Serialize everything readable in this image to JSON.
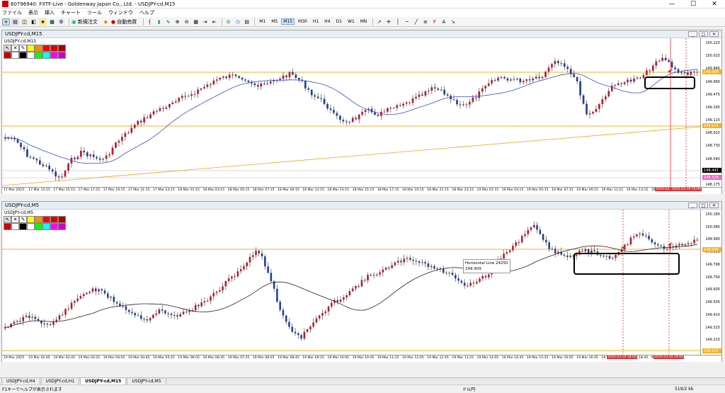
{
  "window": {
    "title": "60796940: FXTF-Live - Goldenway Japan Co., Ltd. - USDJPY-cd,M15",
    "minimize": "—",
    "maximize": "☐",
    "close": "✕"
  },
  "menu": [
    "ファイル",
    "表示",
    "挿入",
    "チャート",
    "ツール",
    "ウィンドウ",
    "ヘルプ"
  ],
  "toolbar": {
    "new_order": "新規注文",
    "auto_trade": "自動売買",
    "timeframes": [
      "M1",
      "M5",
      "M15",
      "M30",
      "H1",
      "H4",
      "D1",
      "W1",
      "MN"
    ],
    "selected_timeframe": "M15"
  },
  "chart_top": {
    "window_title": "USDJPY-cd,M15",
    "symbol_label": "USDJPY-cd,M15",
    "price_ticks": [
      "150.220",
      "150.015",
      "149.845",
      "149.660",
      "149.475",
      "149.295",
      "149.115",
      "148.915",
      "148.730",
      "148.540",
      "148.360",
      "148.175"
    ],
    "price_boxes": [
      {
        "label": "149.909",
        "color": "#f5b324"
      },
      {
        "label": "149.114",
        "color": "#f5b324"
      },
      {
        "label": "148.443",
        "color": "#000000"
      },
      {
        "label": "148.328",
        "color": "#e86ac8"
      }
    ],
    "time_labels": [
      "17 Mar 2025",
      "17 Mar 13:15",
      "17 Mar 15:15",
      "17 Mar 17:15",
      "17 Mar 19:15",
      "17 Mar 21:15",
      "17 Mar 23:15",
      "18 Mar 01:15",
      "18 Mar 03:15",
      "18 Mar 05:15",
      "18 Mar 07:15",
      "18 Mar 09:15",
      "18 Mar 11:15",
      "18 Mar 13:15",
      "18 Mar 15:15",
      "18 Mar 17:15",
      "18 Mar 19:15",
      "18 Mar 21:15",
      "18 Mar 23:15",
      "19 Mar 01:15",
      "19 Mar 03:15",
      "19 Mar 05:15",
      "19 Mar 07:15",
      "19 Mar 09:15",
      "19 Mar 11:15",
      "19 Mar 13:15",
      "19 Mar 15:15"
    ],
    "time_markers": [
      "2025.03..",
      "2025.03.19 15:00"
    ]
  },
  "chart_bottom": {
    "window_title": "USDJPY-cd,M5",
    "symbol_label": "USDJPY-cd,M5",
    "price_ticks": [
      "150.180",
      "150.085",
      "149.990",
      "149.895",
      "149.796",
      "149.700",
      "149.605",
      "149.505",
      "149.410",
      "149.315",
      "149.215",
      "149.120"
    ],
    "price_boxes": [
      {
        "label": "149.909",
        "color": "#f5b324"
      },
      {
        "label": "149.114",
        "color": "#f5b324"
      }
    ],
    "time_labels": [
      "19 Mar 2025",
      "19 Mar 02:05",
      "19 Mar 02:45",
      "19 Mar 03:25",
      "19 Mar 04:05",
      "19 Mar 04:45",
      "19 Mar 05:25",
      "19 Mar 06:05",
      "19 Mar 06:45",
      "19 Mar 07:25",
      "19 Mar 08:05",
      "19 Mar 08:45",
      "19 Mar 09:25",
      "19 Mar 10:05",
      "19 Mar 10:45",
      "19 Mar 11:25",
      "19 Mar 12:05",
      "19 Mar 12:45",
      "19 Mar 13:25",
      "19 Mar 14:05",
      "19 Mar 14:45",
      "19 Mar 15:25",
      "19 Mar 16:05",
      "19 Mar 16:45",
      "19 Mar 17:25",
      "19 Mar 18:45",
      "Mar 20:05"
    ],
    "time_markers": [
      "2025.03.19 18:00",
      "2025.03.19 19:00"
    ],
    "tooltip_line1": "Horizontal Line 24250",
    "tooltip_line2": "149.909"
  },
  "tabs": [
    "USDJPY-cd,H4",
    "USDJPY-cd,H1",
    "USDJPY-cd,M15",
    "USDJPY-cd,M5"
  ],
  "active_tab": "USDJPY-cd,M15",
  "status": {
    "help": "F1キーでヘルプが表示されます",
    "profile": "ドル円",
    "traffic": "519/2 kb"
  },
  "colors": {
    "bull": "#c0152a",
    "bear": "#1f3f9a",
    "ma_top": "#3a4bd8",
    "ma_bottom": "#222222",
    "hline": "#f5b324",
    "trend": "#f5a020",
    "vline": "#e03030"
  }
}
